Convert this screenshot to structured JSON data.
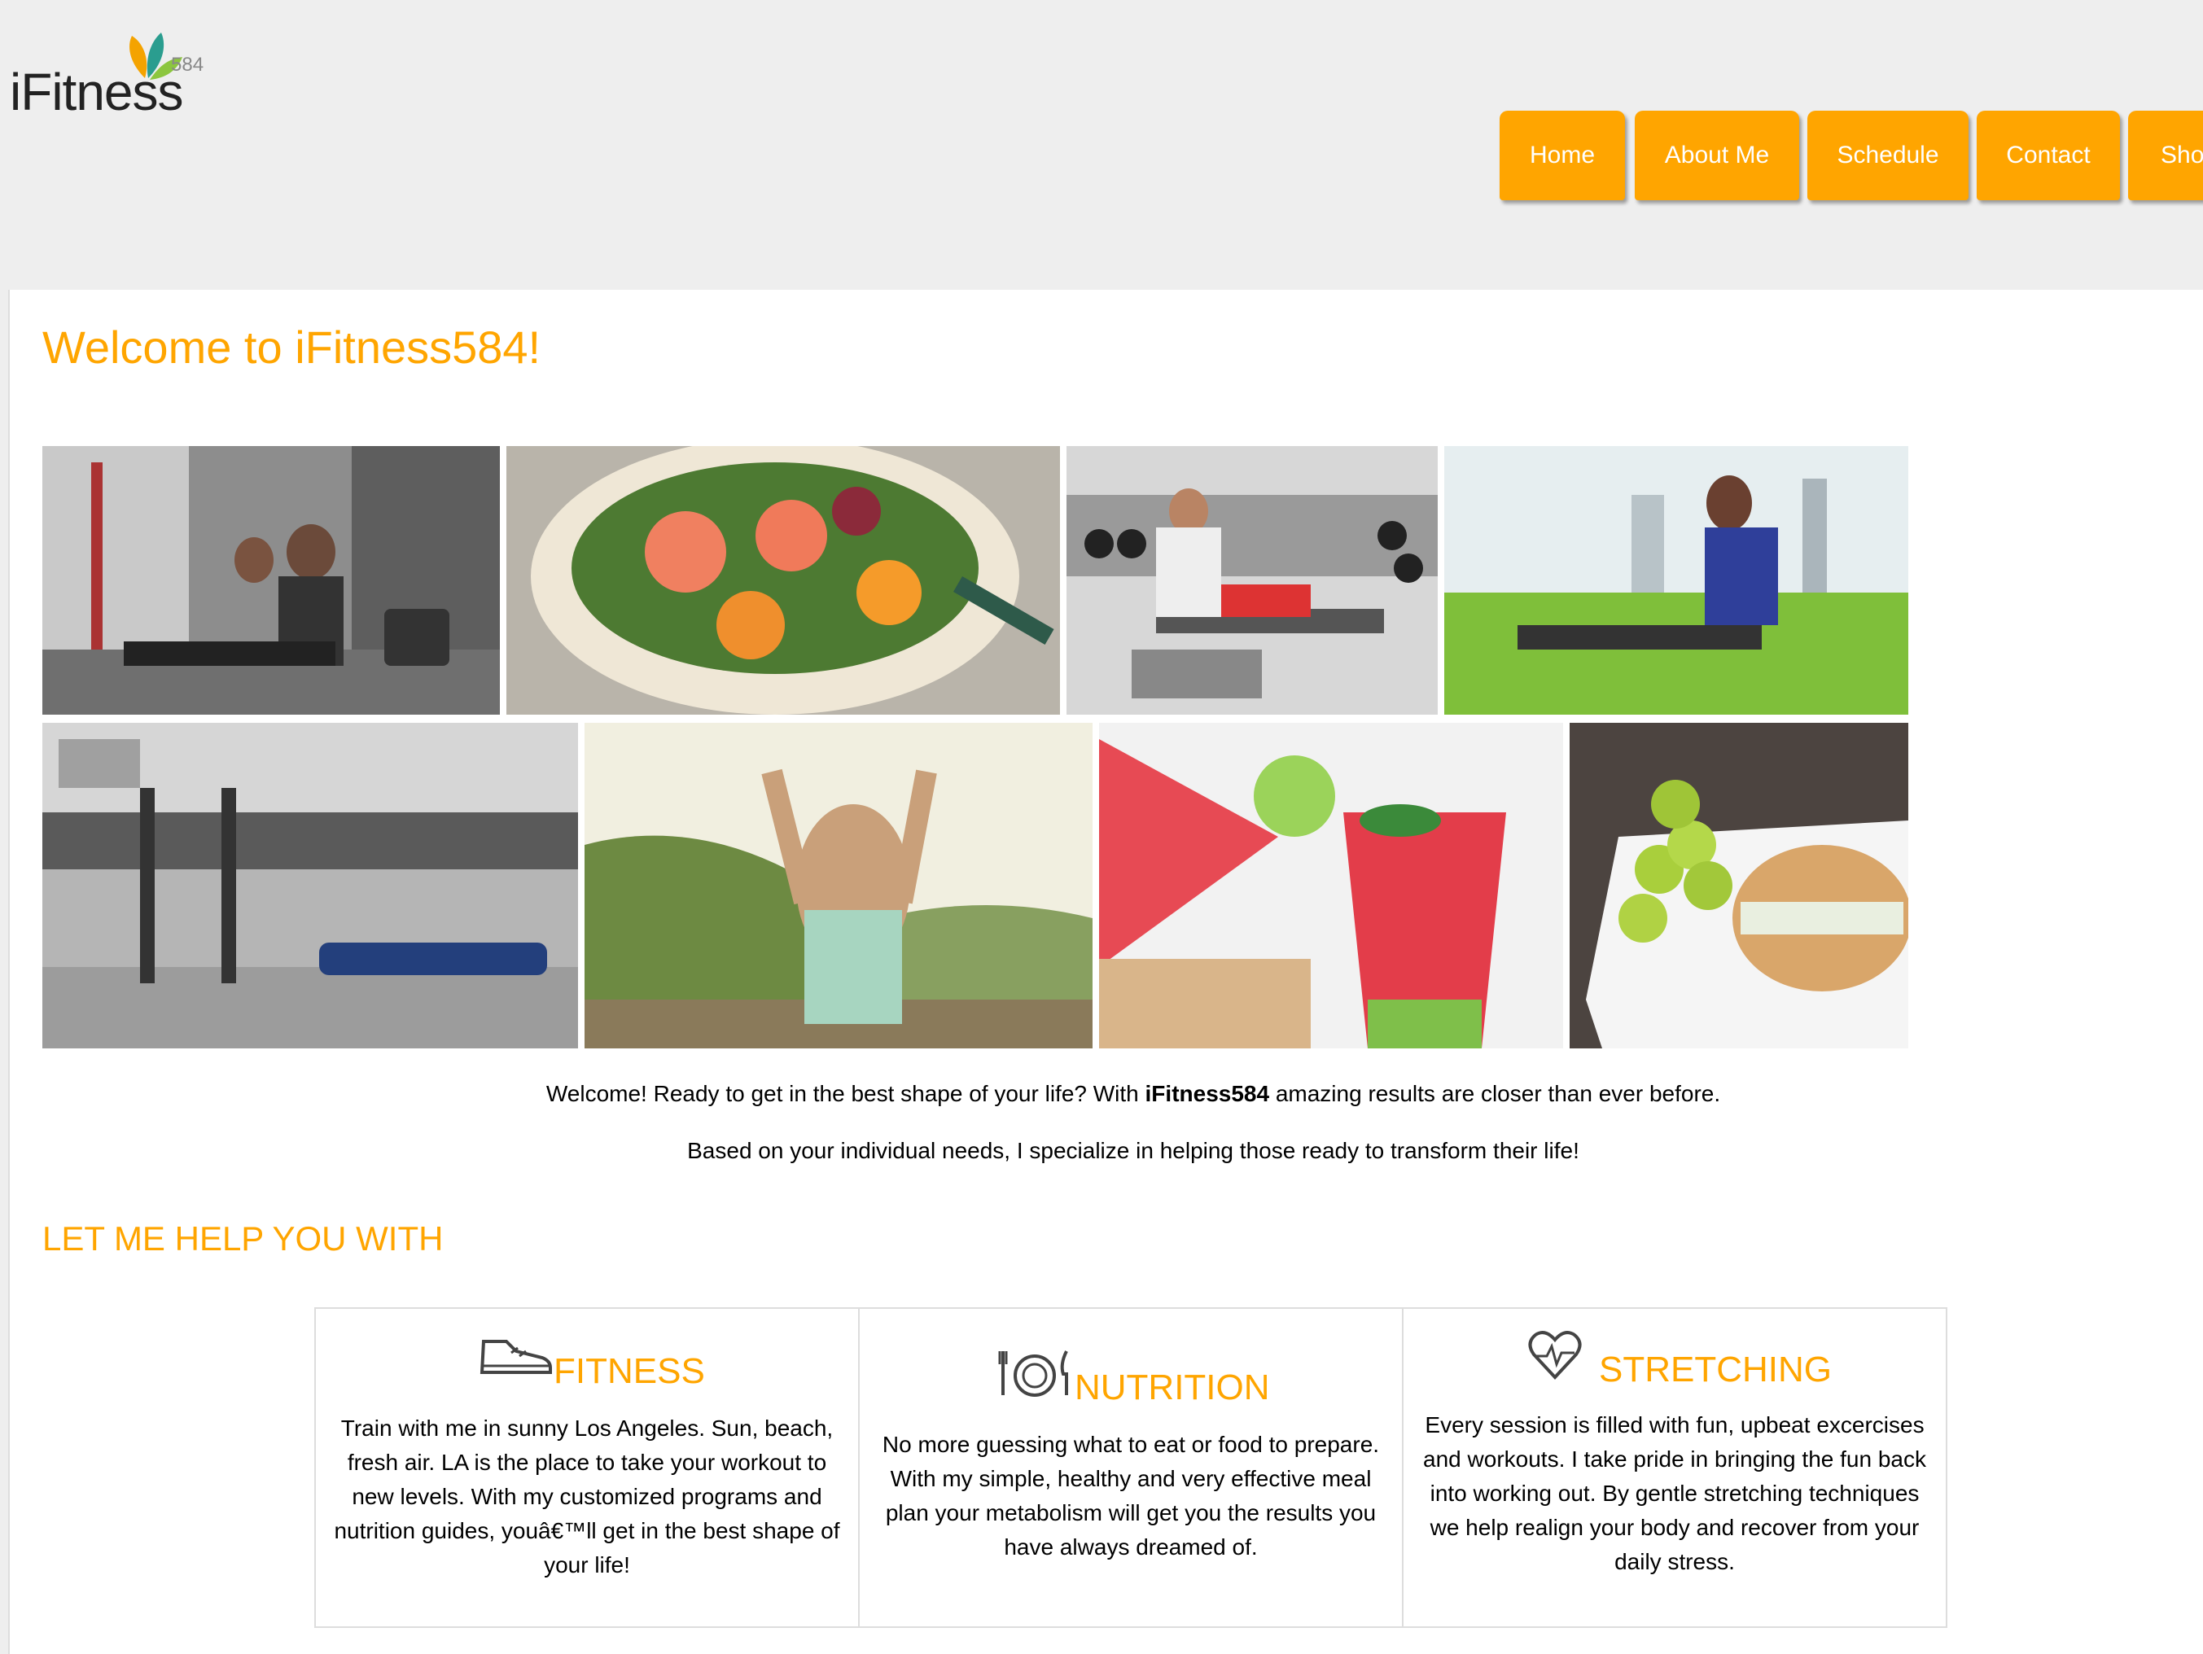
{
  "logo": {
    "name": "iFitness",
    "number": "584",
    "leaf_colors": [
      "#2a9d8f",
      "#f4a300",
      "#8cc63f"
    ]
  },
  "nav": {
    "items": [
      {
        "label": "Home"
      },
      {
        "label": "About Me"
      },
      {
        "label": "Schedule"
      },
      {
        "label": "Contact"
      },
      {
        "label": "Sho"
      }
    ]
  },
  "main": {
    "title": "Welcome to iFitness584!",
    "intro_prefix": "Welcome! Ready to get in the best shape of your life? With ",
    "intro_brand": "iFitness584",
    "intro_suffix": " amazing results are closer than ever before.",
    "intro_line2": "Based on your individual needs, I specialize in helping those ready to transform their life!",
    "help_title": "LET ME HELP YOU WITH",
    "gallery": [
      "gym-friends-photo",
      "salad-bowl-photo",
      "trainer-bench-press-photo",
      "woman-stretching-grass-photo",
      "gym-interior-photo",
      "woman-stretching-coast-photo",
      "watermelon-smoothie-photo",
      "grapes-sandwich-photo"
    ],
    "services": [
      {
        "icon": "sneaker-icon",
        "title": "FITNESS",
        "text": "Train with me in sunny Los Angeles. Sun, beach, fresh air. LA is the place to take your workout to new levels. With my customized programs and nutrition guides, youâ€™ll get in the best shape of your life!"
      },
      {
        "icon": "plate-cutlery-icon",
        "title": "NUTRITION",
        "text": "No more guessing what to eat or food to prepare. With my simple, healthy and very effective meal plan your metabolism will get you the results you have always dreamed of."
      },
      {
        "icon": "heartbeat-icon",
        "title": "STRETCHING",
        "text": "Every session is filled with fun, upbeat excercises and workouts. I take pride in bringing the fun back into working out. By gentle stretching techniques we help realign your body and recover from your daily stress."
      }
    ]
  },
  "colors": {
    "accent": "#ffa500",
    "header_bg": "#eeeeee",
    "panel_bg": "#ffffff"
  }
}
